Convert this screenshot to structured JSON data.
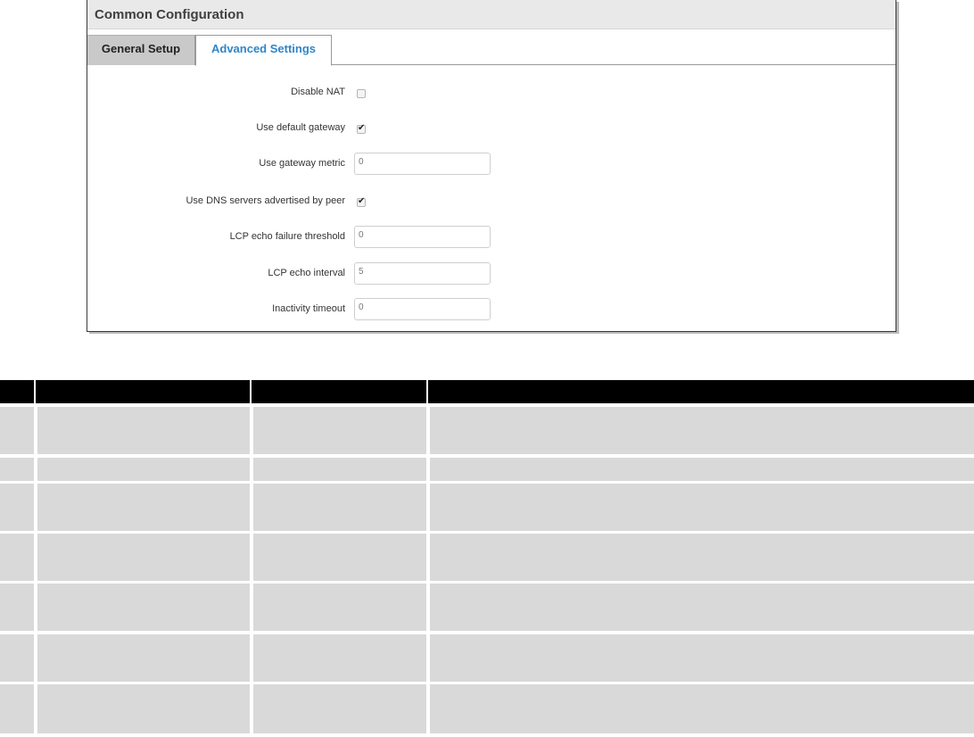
{
  "panel": {
    "title": "Common Configuration",
    "tabs": [
      {
        "label": "General Setup",
        "active": false
      },
      {
        "label": "Advanced Settings",
        "active": true
      }
    ]
  },
  "form": {
    "disable_nat": {
      "label": "Disable NAT",
      "checked": false
    },
    "use_default_gateway": {
      "label": "Use default gateway",
      "checked": true
    },
    "use_gateway_metric": {
      "label": "Use gateway metric",
      "value": "0"
    },
    "use_dns_servers": {
      "label": "Use DNS servers advertised by peer",
      "checked": true
    },
    "lcp_echo_failure_threshold": {
      "label": "LCP echo failure threshold",
      "value": "0"
    },
    "lcp_echo_interval": {
      "label": "LCP echo interval",
      "value": "5"
    },
    "inactivity_timeout": {
      "label": "Inactivity timeout",
      "value": "0"
    }
  },
  "colors": {
    "accent_tab_text": "#2f86c9",
    "header_bg": "#e9e9e9",
    "table_header_bg": "#000000",
    "table_cell_bg": "#d9d9d9"
  },
  "table": {
    "columns": [
      "",
      "",
      "",
      ""
    ],
    "rows": [
      [
        "",
        "",
        "",
        ""
      ],
      [
        "",
        "",
        "",
        ""
      ],
      [
        "",
        "",
        "",
        ""
      ],
      [
        "",
        "",
        "",
        ""
      ],
      [
        "",
        "",
        "",
        ""
      ],
      [
        "",
        "",
        "",
        ""
      ],
      [
        "",
        "",
        "",
        ""
      ]
    ]
  }
}
